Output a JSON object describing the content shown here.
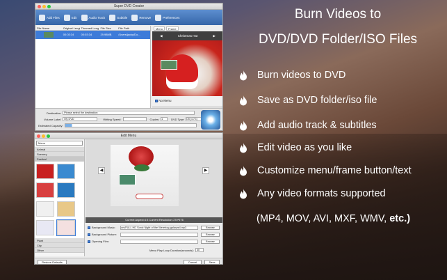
{
  "promo": {
    "title_line1": "Burn Videos to",
    "title_line2": "DVD/DVD Folder/ISO Files",
    "features": [
      "Burn videos to DVD",
      "Save as DVD folder/iso file",
      "Add audio track & subtitles",
      "Edit video as you like",
      "Customize menu/frame button/text",
      "Any video formats supported"
    ],
    "formats_text": "(MP4, MOV, AVI, MXF, WMV,",
    "formats_bold": "etc.)"
  },
  "main_window": {
    "title": "Super DVD Creator",
    "toolbar": [
      "Add Files",
      "Edit",
      "Audio Track",
      "Subtitle",
      "Remove",
      "Preferences"
    ],
    "columns": [
      "File Name",
      "Original Length",
      "Trimmed Length",
      "File Size",
      "File Path"
    ],
    "row": {
      "original": "00:03:34",
      "trimmed": "00:03:34",
      "size": "29.98MB",
      "path": "/Users/jacky/Do..."
    },
    "preview_tabs": [
      "Menu",
      "Frame"
    ],
    "preview_title": "Christmas Hat",
    "no_menu_label": "No Menu",
    "destination_label": "Destination:",
    "destination_value": "Please select the destination",
    "volume_label": "Volume Label:",
    "volume_value": "My DVD",
    "writing_speed_label": "Writing Speed:",
    "copies_label": "Copies:",
    "copies_value": "1",
    "dvd_type_label": "DVD Type:",
    "dvd_type_value": "D5 (4.7G)",
    "capacity_label": "Estimated Capacity:"
  },
  "menu_window": {
    "title": "Edit Menu",
    "menu_select": "Menu",
    "categories_top": [
      "Animal",
      "Scenery",
      "Festival"
    ],
    "categories_bottom": [
      "Plant",
      "City",
      "Other"
    ],
    "aspect_text": "Current Aspect:4:3    Current Resolution:720*576",
    "bg_music_label": "Background Music:",
    "bg_music_value": "urs/FULL HD Sonic  Night of the Werehog-galaxys4.mp3",
    "bg_picture_label": "Background Picture:",
    "opening_film_label": "Opening Film:",
    "browse_label": "Browse",
    "loop_label": "Menu Play Loop Duration(seconds):",
    "loop_value": "30",
    "restore_label": "Restore Defaults",
    "cancel_label": "Cancel",
    "save_label": "Save"
  },
  "colors": {
    "accent": "#3d7bd9",
    "toolbar": "#4a7cc0"
  }
}
